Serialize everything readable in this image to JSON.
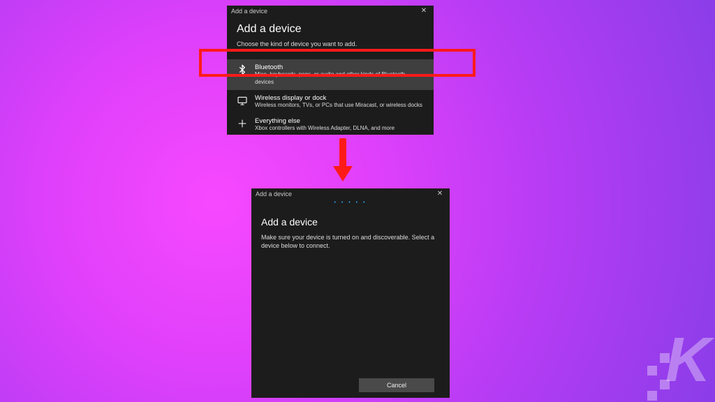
{
  "titlebar": "Add a device",
  "dialog1": {
    "heading": "Add a device",
    "subtext": "Choose the kind of device you want to add.",
    "options": [
      {
        "title": "Bluetooth",
        "desc": "Mice, keyboards, pens, or audio and other kinds of Bluetooth devices"
      },
      {
        "title": "Wireless display or dock",
        "desc": "Wireless monitors, TVs, or PCs that use Miracast, or wireless docks"
      },
      {
        "title": "Everything else",
        "desc": "Xbox controllers with Wireless Adapter, DLNA, and more"
      }
    ]
  },
  "dialog2": {
    "heading": "Add a device",
    "subtext": "Make sure your device is turned on and discoverable. Select a device below to connect.",
    "cancel": "Cancel"
  },
  "watermark": "K"
}
